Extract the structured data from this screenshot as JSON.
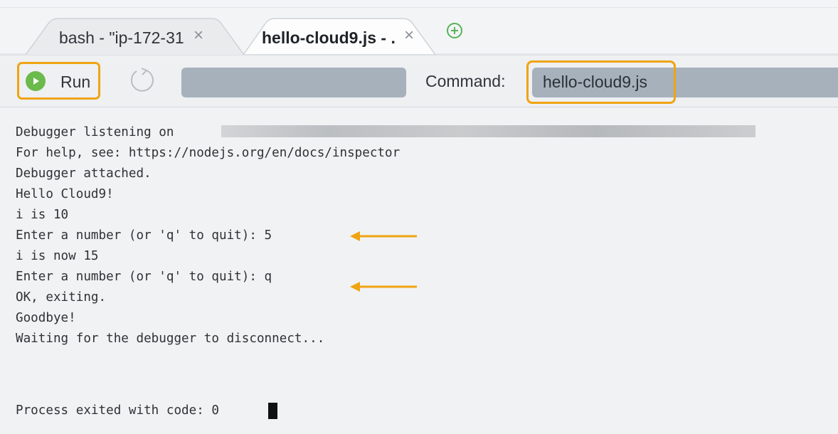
{
  "tabs": [
    {
      "label": "bash - \"ip-172-31",
      "close": "×",
      "active": false
    },
    {
      "label": "hello-cloud9.js - .",
      "close": "×",
      "active": true
    }
  ],
  "toolbar": {
    "run_label": "Run",
    "command_label": "Command:",
    "command_value": "hello-cloud9.js"
  },
  "console": {
    "lines": [
      "Debugger listening on",
      "For help, see: https://nodejs.org/en/docs/inspector",
      "Debugger attached.",
      "Hello Cloud9!",
      "i is 10",
      "Enter a number (or 'q' to quit): 5",
      "i is now 15",
      "Enter a number (or 'q' to quit): q",
      "OK, exiting.",
      "Goodbye!",
      "Waiting for the debugger to disconnect...",
      "Process exited with code: 0"
    ]
  },
  "colors": {
    "highlight": "#f0a411",
    "run_green": "#6bba4c",
    "add_tab_green": "#57b35a",
    "input_gray": "#a6b1bc"
  },
  "icons": {
    "run": "play-icon",
    "restart": "restart-icon",
    "add_tab": "plus-circle-icon",
    "tab_close": "close-icon"
  }
}
